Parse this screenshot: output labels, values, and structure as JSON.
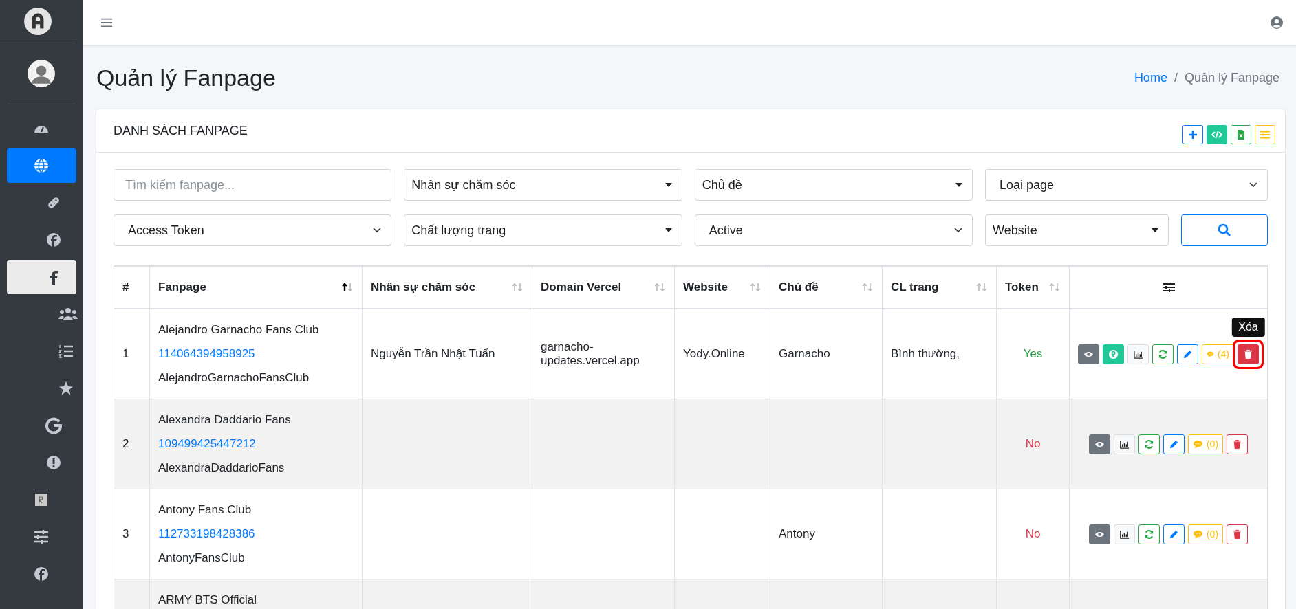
{
  "sidebar": {
    "items": [
      {
        "kind": "dashboard",
        "selected": false,
        "hovered": false
      },
      {
        "kind": "globe",
        "selected": true,
        "hovered": false,
        "children": [
          {
            "kind": "link",
            "selected": false,
            "hovered": false
          },
          {
            "kind": "facebook-circle",
            "selected": false,
            "hovered": false
          },
          {
            "kind": "facebook-f",
            "selected": false,
            "hovered": true,
            "children": [
              {
                "kind": "users",
                "selected": false,
                "hovered": false
              },
              {
                "kind": "list",
                "selected": false,
                "hovered": false
              },
              {
                "kind": "star",
                "selected": false,
                "hovered": false
              }
            ]
          },
          {
            "kind": "google",
            "selected": false,
            "hovered": false
          },
          {
            "kind": "alert",
            "selected": false,
            "hovered": false
          }
        ]
      },
      {
        "kind": "r-image",
        "selected": false,
        "hovered": false
      },
      {
        "kind": "sliders",
        "selected": false,
        "hovered": false
      },
      {
        "kind": "facebook-circle",
        "selected": false,
        "hovered": false
      }
    ]
  },
  "page_title": "Quản lý Fanpage",
  "breadcrumb": {
    "separator": "/",
    "items": [
      {
        "label": "Home",
        "link": true
      },
      {
        "label": "Quản lý Fanpage",
        "link": false
      }
    ]
  },
  "card": {
    "title": "DANH SÁCH FANPAGE",
    "tools": [
      {
        "kind": "add"
      },
      {
        "kind": "code"
      },
      {
        "kind": "excel"
      },
      {
        "kind": "sliders"
      }
    ]
  },
  "filters": [
    {
      "kind": "input",
      "placeholder": "Tìm kiếm fanpage..."
    },
    {
      "kind": "select2",
      "value": "Nhân sự chăm sóc"
    },
    {
      "kind": "select2",
      "value": "Chủ đề"
    },
    {
      "kind": "native",
      "value": "Loại page"
    },
    {
      "kind": "native",
      "value": "Access Token"
    },
    {
      "kind": "select2",
      "value": "Chất lượng trang"
    },
    {
      "kind": "native",
      "value": "Active"
    },
    {
      "kind": "select2",
      "value": "Website"
    }
  ],
  "table": {
    "columns": [
      {
        "kind": "text",
        "label": "#",
        "sortable": false
      },
      {
        "kind": "text",
        "label": "Fanpage",
        "sortable": true,
        "sorted_ascending": true
      },
      {
        "kind": "text",
        "label": "Nhân sự chăm sóc",
        "sortable": true,
        "sorted_ascending": false
      },
      {
        "kind": "text",
        "label": "Domain Vercel",
        "sortable": true,
        "sorted_ascending": false
      },
      {
        "kind": "text",
        "label": "Website",
        "sortable": true,
        "sorted_ascending": false
      },
      {
        "kind": "text",
        "label": "Chủ đề",
        "sortable": true,
        "sorted_ascending": false
      },
      {
        "kind": "text",
        "label": "CL trang",
        "sortable": true,
        "sorted_ascending": false
      },
      {
        "kind": "text",
        "label": "Token",
        "sortable": true,
        "sorted_ascending": false
      },
      {
        "kind": "settings"
      }
    ],
    "rows": [
      {
        "index": "1",
        "name": "Alejandro Garnacho Fans Club",
        "page_id": "114064394958925",
        "slug": "AlejandroGarnachoFansClub",
        "staff": "Nguyễn Trần Nhật Tuấn",
        "domain": "garnacho-updates.vercel.app",
        "website": "Yody.Online",
        "topic": "Garnacho",
        "quality": "Bình thường,",
        "token": {
          "text": "Yes",
          "ok": true
        },
        "actions": [
          {
            "kind": "view"
          },
          {
            "kind": "r"
          },
          {
            "kind": "chart"
          },
          {
            "kind": "refresh"
          },
          {
            "kind": "edit"
          },
          {
            "kind": "comment",
            "count": "(4)"
          },
          {
            "kind": "delete",
            "hovered": true,
            "tooltip": "Xóa"
          }
        ]
      },
      {
        "index": "2",
        "name": "Alexandra Daddario Fans",
        "page_id": "109499425447212",
        "slug": "AlexandraDaddarioFans",
        "token": {
          "text": "No",
          "ok": false
        },
        "actions": [
          {
            "kind": "view"
          },
          {
            "kind": "chart"
          },
          {
            "kind": "refresh"
          },
          {
            "kind": "edit"
          },
          {
            "kind": "comment",
            "count": "(0)"
          },
          {
            "kind": "delete",
            "hovered": false
          }
        ]
      },
      {
        "index": "3",
        "name": "Antony Fans Club",
        "page_id": "112733198428386",
        "slug": "AntonyFansClub",
        "topic": "Antony",
        "token": {
          "text": "No",
          "ok": false
        },
        "actions": [
          {
            "kind": "view"
          },
          {
            "kind": "chart"
          },
          {
            "kind": "refresh"
          },
          {
            "kind": "edit"
          },
          {
            "kind": "comment",
            "count": "(0)"
          },
          {
            "kind": "delete",
            "hovered": false
          }
        ]
      },
      {
        "name": "ARMY BTS Official"
      }
    ]
  }
}
